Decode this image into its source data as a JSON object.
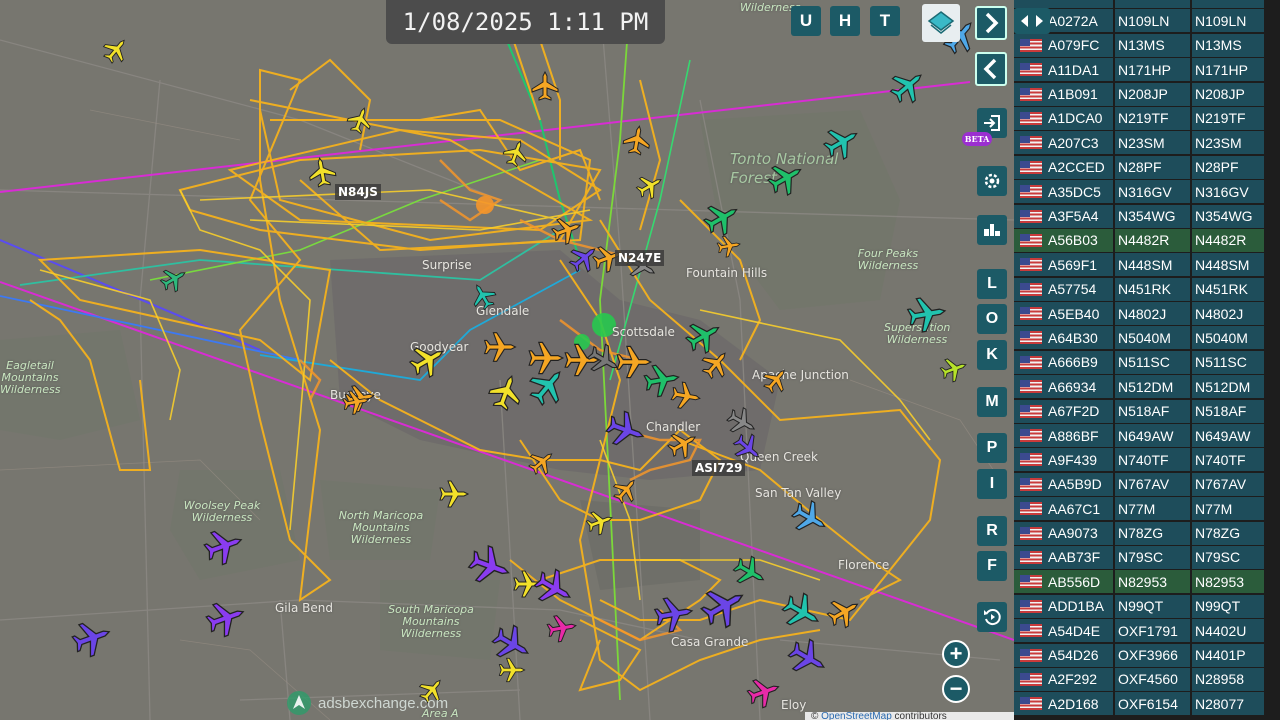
{
  "clock": "1/08/2025 1:11 PM",
  "toolbar_top": [
    "U",
    "H",
    "T"
  ],
  "side_buttons": [
    "L",
    "O",
    "K",
    "M",
    "P",
    "I",
    "R",
    "F"
  ],
  "beta_badge": "BETA",
  "map_labels": {
    "callsigns": [
      "N84JS",
      "N247E",
      "ASI729"
    ],
    "places": [
      "Surprise",
      "Glendale",
      "Goodyear",
      "Buckeye",
      "Fountain Hills",
      "Scottsdale",
      "Apache Junction",
      "Chandler",
      "Queen Creek",
      "San Tan Valley",
      "Gila Bend",
      "Casa Grande",
      "Eloy",
      "Florence",
      "Tonto National Forest"
    ],
    "wilderness": [
      "Eagletail Mountains Wilderness",
      "Woolsey Peak Wilderness",
      "North Maricopa Mountains Wilderness",
      "South Maricopa Mountains Wilderness",
      "Four Peaks Wilderness",
      "Superstition Wilderness",
      "Wilderness",
      "Area A"
    ]
  },
  "watermark": "adsbexchange.com",
  "attribution": {
    "prefix": "©",
    "link": "OpenStreetMap",
    "suffix": "contributors"
  },
  "aircraft_list": [
    {
      "hex": "A0272A",
      "reg": "N109LN",
      "type": "N109LN"
    },
    {
      "hex": "A079FC",
      "reg": "N13MS",
      "type": "N13MS"
    },
    {
      "hex": "A11DA1",
      "reg": "N171HP",
      "type": "N171HP"
    },
    {
      "hex": "A1B091",
      "reg": "N208JP",
      "type": "N208JP"
    },
    {
      "hex": "A1DCA0",
      "reg": "N219TF",
      "type": "N219TF"
    },
    {
      "hex": "A207C3",
      "reg": "N23SM",
      "type": "N23SM"
    },
    {
      "hex": "A2CCED",
      "reg": "N28PF",
      "type": "N28PF"
    },
    {
      "hex": "A35DC5",
      "reg": "N316GV",
      "type": "N316GV"
    },
    {
      "hex": "A3F5A4",
      "reg": "N354WG",
      "type": "N354WG"
    },
    {
      "hex": "A56B03",
      "reg": "N4482R",
      "type": "N4482R",
      "selected": true
    },
    {
      "hex": "A569F1",
      "reg": "N448SM",
      "type": "N448SM"
    },
    {
      "hex": "A57754",
      "reg": "N451RK",
      "type": "N451RK"
    },
    {
      "hex": "A5EB40",
      "reg": "N4802J",
      "type": "N4802J"
    },
    {
      "hex": "A64B30",
      "reg": "N5040M",
      "type": "N5040M"
    },
    {
      "hex": "A666B9",
      "reg": "N511SC",
      "type": "N511SC"
    },
    {
      "hex": "A66934",
      "reg": "N512DM",
      "type": "N512DM"
    },
    {
      "hex": "A67F2D",
      "reg": "N518AF",
      "type": "N518AF"
    },
    {
      "hex": "A886BF",
      "reg": "N649AW",
      "type": "N649AW"
    },
    {
      "hex": "A9F439",
      "reg": "N740TF",
      "type": "N740TF"
    },
    {
      "hex": "AA5B9D",
      "reg": "N767AV",
      "type": "N767AV"
    },
    {
      "hex": "AA67C1",
      "reg": "N77M",
      "type": "N77M"
    },
    {
      "hex": "AA9073",
      "reg": "N78ZG",
      "type": "N78ZG"
    },
    {
      "hex": "AAB73F",
      "reg": "N79SC",
      "type": "N79SC"
    },
    {
      "hex": "AB556D",
      "reg": "N82953",
      "type": "N82953",
      "selected": true
    },
    {
      "hex": "ADD1BA",
      "reg": "N99QT",
      "type": "N99QT"
    },
    {
      "hex": "A54D4E",
      "reg": "OXF1791",
      "type": "N4402U"
    },
    {
      "hex": "A54D26",
      "reg": "OXF3966",
      "type": "N4401P"
    },
    {
      "hex": "A2F292",
      "reg": "OXF4560",
      "type": "N28958"
    },
    {
      "hex": "A2D168",
      "reg": "OXF6154",
      "type": "N28077"
    }
  ]
}
